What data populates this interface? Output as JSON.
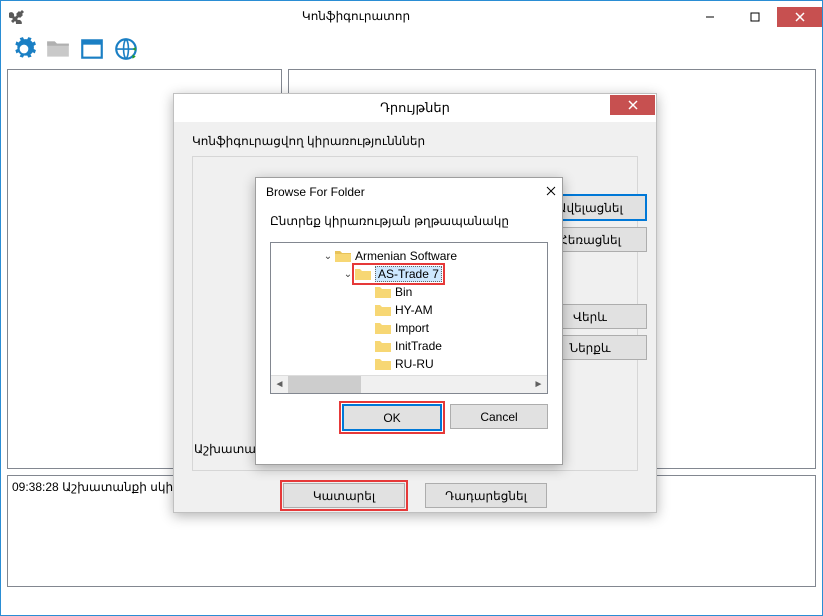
{
  "window": {
    "title": "Կոնֆիգուրատոր"
  },
  "status": {
    "time": "09:38:28",
    "text": "Աշխատանքի սկիզբ"
  },
  "dialog1": {
    "title": "Դրույթներ",
    "group_label": "Կոնֆիգուրացվող կիրառությունններ",
    "add": "Ավելացնել",
    "remove": "Հեռացնել",
    "up": "Վերև",
    "down": "Ներքև",
    "work_label": "Աշխատանք",
    "execute": "Կատարել",
    "cancel": "Դադարեցնել"
  },
  "dialog2": {
    "title": "Browse For Folder",
    "instruction": "Ընտրեք կիրառության թղթապանակը",
    "ok": "OK",
    "cancel": "Cancel",
    "tree": {
      "root": "Armenian Software",
      "selected": "AS-Trade 7",
      "children": [
        "Bin",
        "HY-AM",
        "Import",
        "InitTrade",
        "RU-RU"
      ]
    }
  }
}
